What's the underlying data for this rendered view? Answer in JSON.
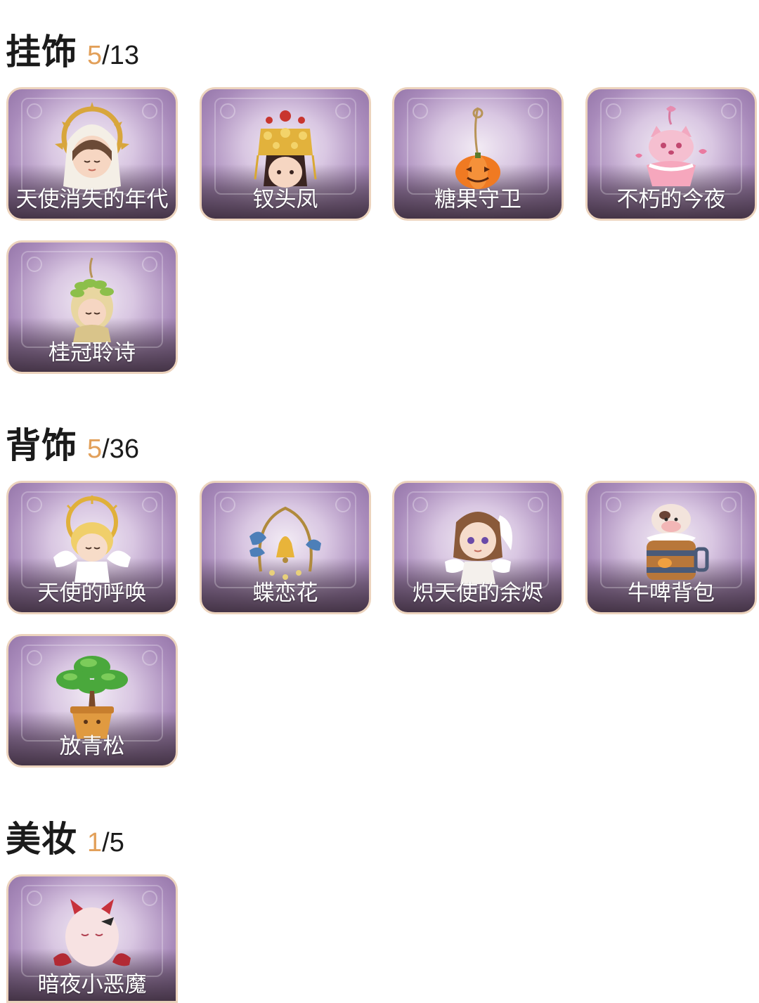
{
  "sections": [
    {
      "title": "挂饰",
      "owned": "5",
      "total": "/13",
      "items": [
        {
          "label": "天使消失的年代",
          "icon": "angel-halo-girl-icon"
        },
        {
          "label": "钗头凤",
          "icon": "phoenix-crown-girl-icon"
        },
        {
          "label": "糖果守卫",
          "icon": "pumpkin-candy-icon"
        },
        {
          "label": "不朽的今夜",
          "icon": "pink-fox-cupcake-icon"
        },
        {
          "label": "桂冠聆诗",
          "icon": "laurel-poet-icon"
        }
      ]
    },
    {
      "title": "背饰",
      "owned": "5",
      "total": "/36",
      "items": [
        {
          "label": "天使的呼唤",
          "icon": "golden-angel-icon"
        },
        {
          "label": "蝶恋花",
          "icon": "butterfly-bell-icon"
        },
        {
          "label": "炽天使的余烬",
          "icon": "seraph-girl-icon"
        },
        {
          "label": "牛啤背包",
          "icon": "cow-beer-barrel-icon"
        },
        {
          "label": "放青松",
          "icon": "bonsai-pine-icon"
        }
      ]
    },
    {
      "title": "美妆",
      "owned": "1",
      "total": "/5",
      "items": [
        {
          "label": "暗夜小恶魔",
          "icon": "little-devil-icon"
        }
      ]
    }
  ]
}
